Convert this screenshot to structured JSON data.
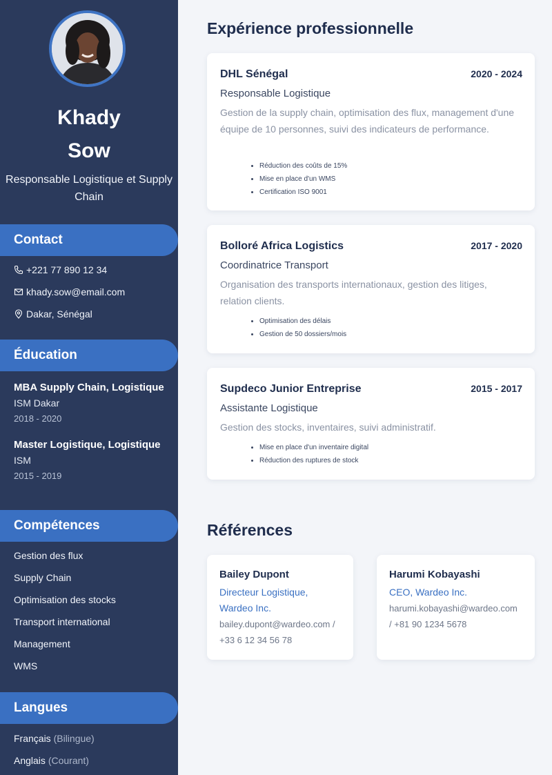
{
  "profile": {
    "first_name": "Khady",
    "last_name": "Sow",
    "title": "Responsable Logistique et Supply Chain"
  },
  "contact": {
    "heading": "Contact",
    "phone": "+221 77 890 12 34",
    "email": "khady.sow@email.com",
    "location": "Dakar, Sénégal"
  },
  "education": {
    "heading": "Éducation",
    "items": [
      {
        "degree": "MBA Supply Chain, Logistique",
        "school": "ISM Dakar",
        "years": "2018 - 2020"
      },
      {
        "degree": "Master Logistique, Logistique",
        "school": "ISM",
        "years": "2015 - 2019"
      }
    ]
  },
  "skills": {
    "heading": "Compétences",
    "items": [
      "Gestion des flux",
      "Supply Chain",
      "Optimisation des stocks",
      "Transport international",
      "Management",
      "WMS"
    ]
  },
  "languages": {
    "heading": "Langues",
    "items": [
      {
        "name": "Français",
        "level": "(Bilingue)"
      },
      {
        "name": "Anglais",
        "level": "(Courant)"
      }
    ]
  },
  "experience": {
    "heading": "Expérience professionnelle",
    "jobs": [
      {
        "company": "DHL Sénégal",
        "dates": "2020 - 2024",
        "role": "Responsable Logistique",
        "description": "Gestion de la supply chain, optimisation des flux, management d'une équipe de 10 personnes, suivi des indicateurs de performance.",
        "achievements": [
          "Réduction des coûts de 15%",
          "Mise en place d'un WMS",
          "Certification ISO 9001"
        ]
      },
      {
        "company": "Bolloré Africa Logistics",
        "dates": "2017 - 2020",
        "role": "Coordinatrice Transport",
        "description": "Organisation des transports internationaux, gestion des litiges, relation clients.",
        "achievements": [
          "Optimisation des délais",
          "Gestion de 50 dossiers/mois"
        ]
      },
      {
        "company": "Supdeco Junior Entreprise",
        "dates": "2015 - 2017",
        "role": "Assistante Logistique",
        "description": "Gestion des stocks, inventaires, suivi administratif.",
        "achievements": [
          "Mise en place d'un inventaire digital",
          "Réduction des ruptures de stock"
        ]
      }
    ]
  },
  "references": {
    "heading": "Références",
    "items": [
      {
        "name": "Bailey Dupont",
        "position": "Directeur Logistique, Wardeo Inc.",
        "contact": "bailey.dupont@wardeo.com / +33 6 12 34 56 78"
      },
      {
        "name": "Harumi Kobayashi",
        "position": "CEO, Wardeo Inc.",
        "contact": "harumi.kobayashi@wardeo.com / +81 90 1234 5678"
      }
    ]
  },
  "colors": {
    "sidebar": "#2b3a5c",
    "accent": "#3a70c2",
    "page": "#f3f5f9"
  }
}
